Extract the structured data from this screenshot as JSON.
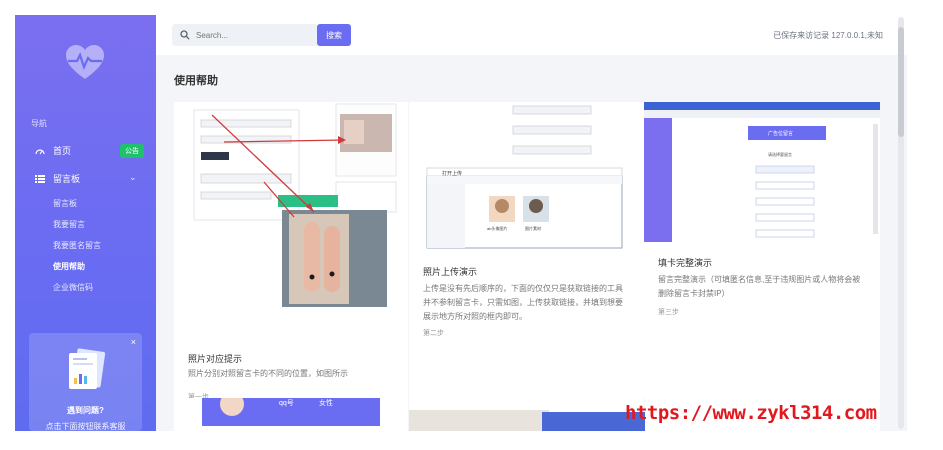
{
  "sidebar": {
    "section_label": "导航",
    "items": [
      {
        "label": "首页",
        "badge": "公告"
      },
      {
        "label": "留言板"
      }
    ],
    "sub_items": [
      "留言板",
      "我要留言",
      "我要匿名留言",
      "使用帮助",
      "企业微信码"
    ],
    "active_sub": "使用帮助",
    "promo": {
      "title": "遇到问题?",
      "subtitle": "点击下面按钮联系客服"
    }
  },
  "topbar": {
    "search_placeholder": "Search...",
    "search_button": "搜索",
    "visit_record": "已保存来访记录 127.0.0.1,未知"
  },
  "page_title": "使用帮助",
  "cards": [
    {
      "title": "照片对应提示",
      "desc": "照片分别对照留言卡的不同的位置，如图所示",
      "step": "第一步"
    },
    {
      "title": "照片上传演示",
      "desc": "上传是没有先后顺序的，下面的仅仅只是获取链接的工具并不参制留言卡，只需如图，上传获取链接，并填到想要展示地方所对照的框内即可。",
      "step": "第二步"
    },
    {
      "title": "填卡完整演示",
      "desc": "留言完整演示（可填匿名信息,至于违规图片或人物将会被删除留言卡封禁IP）",
      "step": "第三步"
    }
  ],
  "card_shots": {
    "file_dialog_title": "打开上传",
    "file_1": "ab头像图片",
    "file_2": "图片素材",
    "form_button": "广告位留言",
    "form_header": "请选择要留言"
  },
  "bottom_cards": {
    "qq_label": "qq号",
    "female": "女性"
  },
  "watermark": "https://www.zykl314.com",
  "colors": {
    "accent": "#6a6cf2",
    "badge": "#1fc26b",
    "watermark": "#e1191f"
  }
}
